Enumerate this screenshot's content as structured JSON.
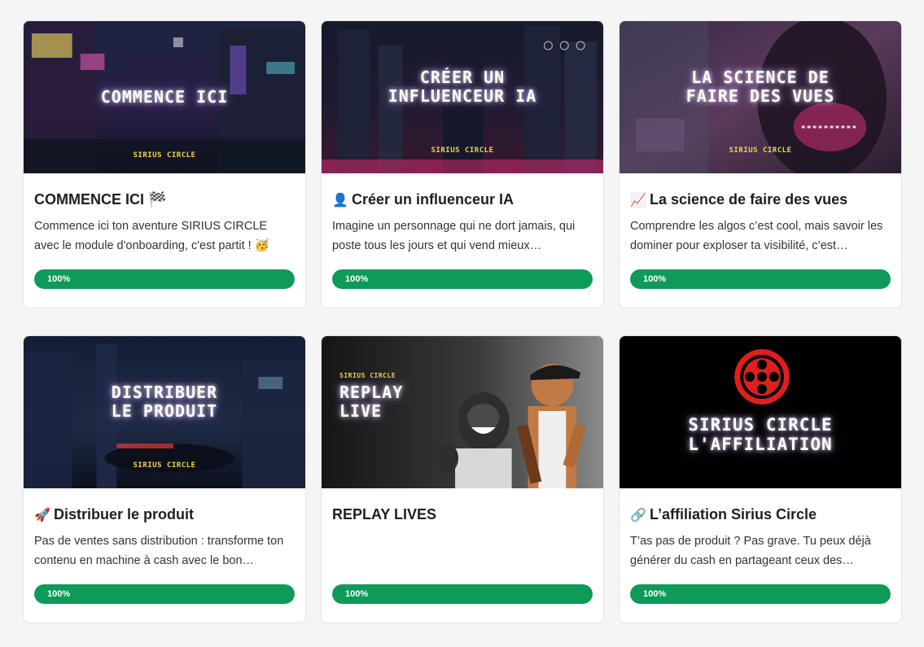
{
  "courses": [
    {
      "thumb_title": "COMMENCE ICI",
      "thumb_brand": "SIRIUS CIRCLE",
      "emoji": "",
      "title": "COMMENCE ICI 🏁",
      "description": "Commence ici ton aventure SIRIUS CIRCLE avec le module d'onboarding, c'est partit ! 🥳",
      "progress_label": "100%",
      "progress_value": 100
    },
    {
      "thumb_title": "CRÉER UN\nINFLUENCEUR IA",
      "thumb_brand": "SIRIUS CIRCLE",
      "emoji": "👤",
      "title": "Créer un influenceur IA",
      "description": "Imagine un personnage qui ne dort jamais, qui poste tous les jours et qui vend mieux…",
      "progress_label": "100%",
      "progress_value": 100
    },
    {
      "thumb_title": "LA SCIENCE DE\nFAIRE DES VUES",
      "thumb_brand": "SIRIUS CIRCLE",
      "emoji": "📈",
      "title": "La science de faire des vues",
      "description": "Comprendre les algos c’est cool, mais savoir les dominer pour exploser ta visibilité, c’est…",
      "progress_label": "100%",
      "progress_value": 100
    },
    {
      "thumb_title": "DISTRIBUER\nLE PRODUIT",
      "thumb_brand": "SIRIUS CIRCLE",
      "emoji": "🚀",
      "title": "Distribuer le produit",
      "description": "Pas de ventes sans distribution : transforme ton contenu en machine à cash avec le bon…",
      "progress_label": "100%",
      "progress_value": 100
    },
    {
      "thumb_title": "REPLAY\nLIVE",
      "thumb_brand": "SIRIUS CIRCLE",
      "emoji": "",
      "title": "REPLAY LIVES",
      "description": "",
      "progress_label": "100%",
      "progress_value": 100
    },
    {
      "thumb_title": "SIRIUS CIRCLE\nL'AFFILIATION",
      "thumb_brand": "",
      "emoji": "🔗",
      "title": "L’affiliation Sirius Circle",
      "description": "T’as pas de produit ? Pas grave. Tu peux déjà générer du cash en partageant ceux des…",
      "progress_label": "100%",
      "progress_value": 100
    }
  ],
  "colors": {
    "progress": "#0e9a58",
    "brand_yellow": "#f5d24a",
    "logo_red": "#e01e1e"
  }
}
